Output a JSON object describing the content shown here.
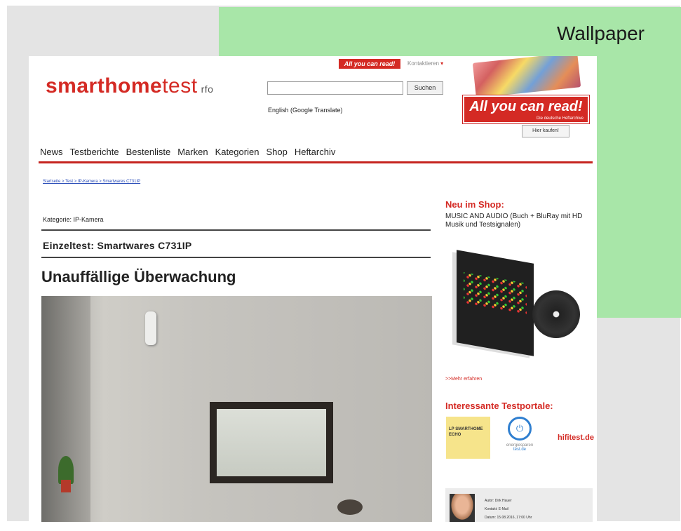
{
  "slide": {
    "wallpaper_label": "Wallpaper",
    "wallpaper_color": "#a8e6a8"
  },
  "header": {
    "logo_bold": "smarthome",
    "logo_light": "test",
    "logo_suffix": "rfo",
    "search_button": "Suchen",
    "translate_link": "English (Google Translate)",
    "top_badge": "All you can read!",
    "top_dropdown": "Kontaktieren"
  },
  "ad": {
    "headline": "All you can read!",
    "subline": "Die deutsche Heftarchive",
    "buy_button": "Hier kaufen!"
  },
  "nav": {
    "items": [
      "News",
      "Testberichte",
      "Bestenliste",
      "Marken",
      "Kategorien",
      "Shop",
      "Heftarchiv"
    ]
  },
  "article": {
    "breadcrumb": "Startseite > Test > IP-Kamera > Smartwares C731IP",
    "category": "Kategorie: IP-Kamera",
    "test_title": "Einzeltest: Smartwares C731IP",
    "headline": "Unauffällige Überwachung"
  },
  "sidebar": {
    "shop_title": "Neu im Shop:",
    "shop_text": "MUSIC AND AUDIO (Buch + BluRay mit HD Musik und Testsignalen)",
    "more_link": ">>Mehr erfahren",
    "portale_title": "Interessante Testportale:",
    "portal1": "LP SMARTHOME ECHO",
    "portal2_text": "energiesparen",
    "portal2_link": "test.de",
    "portal3": "hifitest.de",
    "author_lines": [
      "Autor: Dirk Hauer",
      "Kontakt: E-Mail",
      "Datum: 15.08.2016, 17:00 Uhr"
    ]
  },
  "colors": {
    "brand_red": "#d42a24",
    "link_blue": "#2a4db8"
  }
}
